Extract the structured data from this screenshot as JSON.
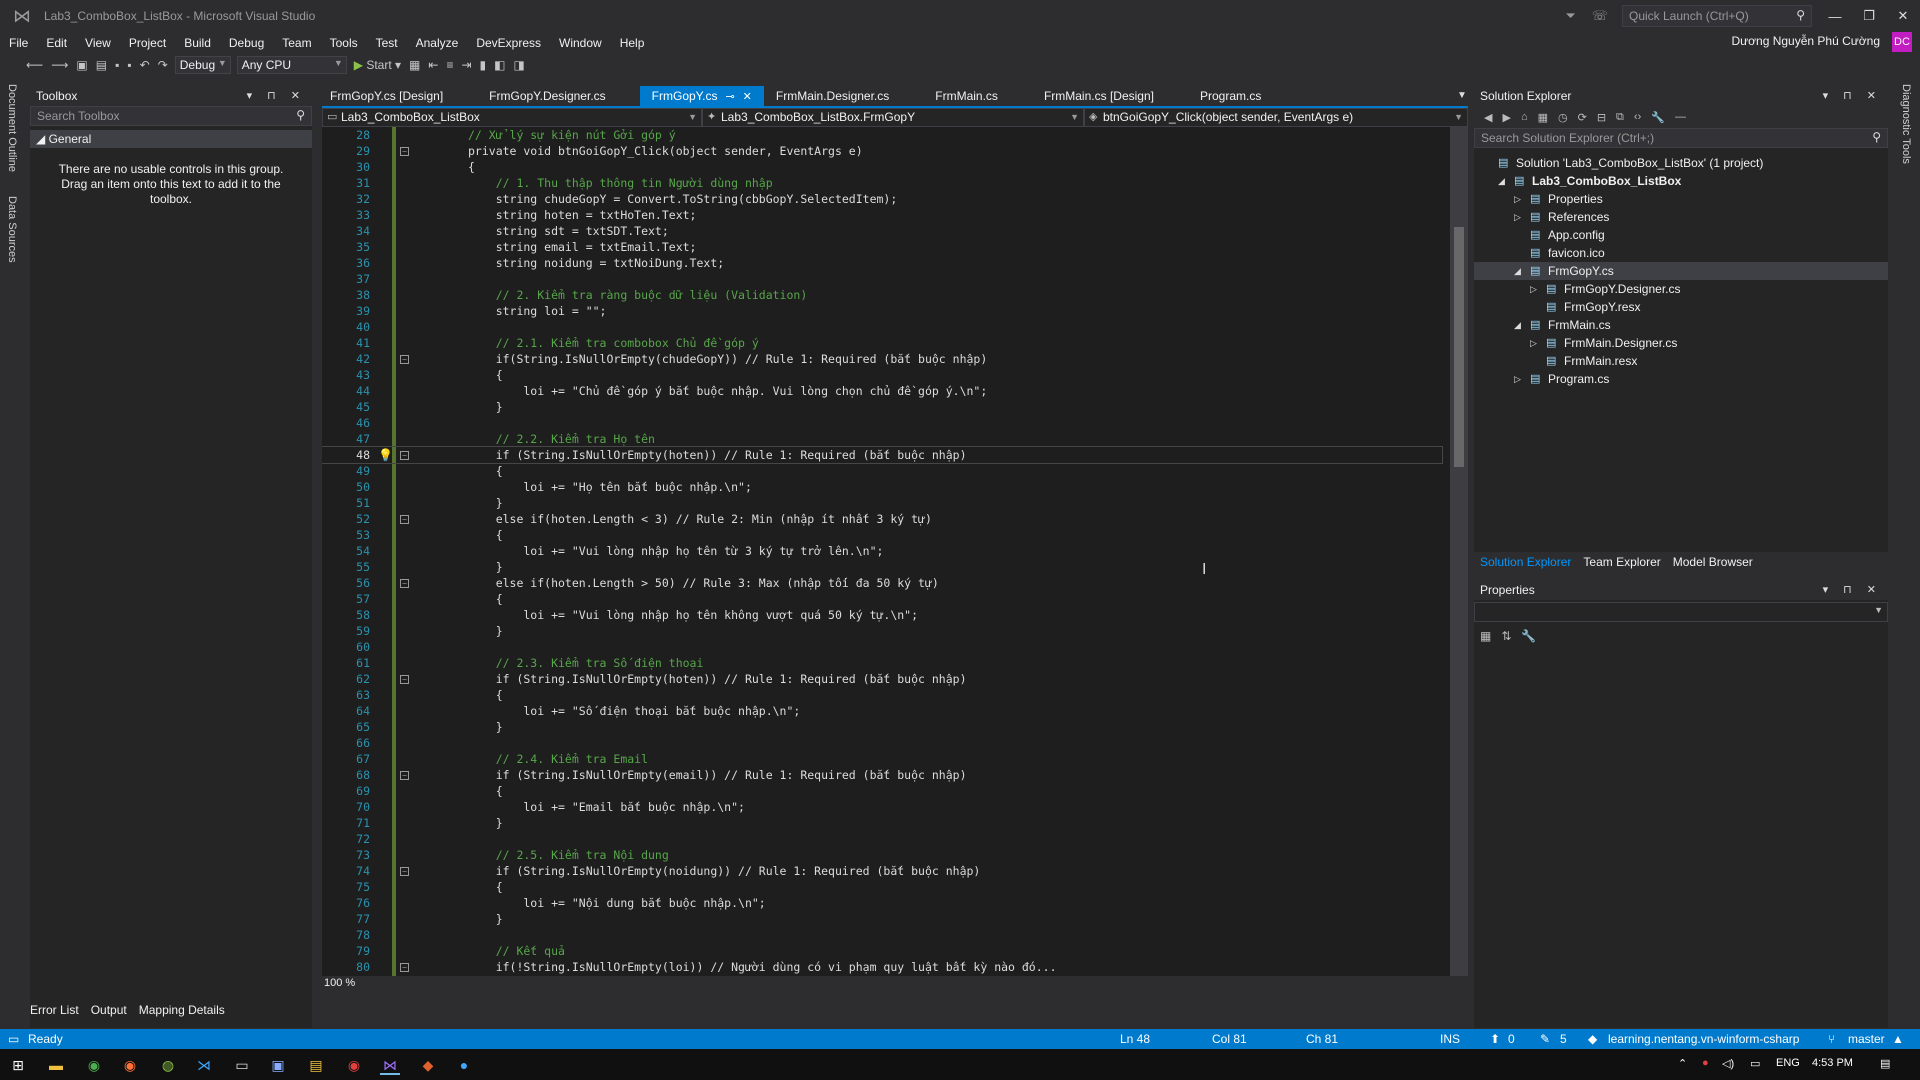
{
  "window": {
    "title": "Lab3_ComboBox_ListBox - Microsoft Visual Studio",
    "quick_launch_placeholder": "Quick Launch (Ctrl+Q)",
    "user_name": "Dương Nguyễn Phú Cường",
    "user_initials": "DC"
  },
  "menu": [
    "File",
    "Edit",
    "View",
    "Project",
    "Build",
    "Debug",
    "Team",
    "Tools",
    "Test",
    "Analyze",
    "DevExpress",
    "Window",
    "Help"
  ],
  "toolbar": {
    "configuration": "Debug",
    "platform": "Any CPU",
    "start_label": "Start"
  },
  "left_strip": [
    "Document Outline",
    "Data Sources"
  ],
  "right_strip": [
    "Diagnostic Tools"
  ],
  "toolbox": {
    "title": "Toolbox",
    "search_placeholder": "Search Toolbox",
    "group": "General",
    "empty_message": "There are no usable controls in this group. Drag an item onto this text to add it to the toolbox."
  },
  "tabs": [
    {
      "label": "FrmGopY.cs [Design]",
      "active": false
    },
    {
      "label": "FrmGopY.Designer.cs",
      "active": false
    },
    {
      "label": "FrmGopY.cs",
      "active": true
    },
    {
      "label": "FrmMain.Designer.cs",
      "active": false
    },
    {
      "label": "FrmMain.cs",
      "active": false
    },
    {
      "label": "FrmMain.cs [Design]",
      "active": false
    },
    {
      "label": "Program.cs",
      "active": false
    }
  ],
  "navbar": {
    "project": "Lab3_ComboBox_ListBox",
    "class": "Lab3_ComboBox_ListBox.FrmGopY",
    "member": "btnGoiGopY_Click(object sender, EventArgs e)"
  },
  "code": {
    "current_line": 48,
    "lines": [
      {
        "n": 28,
        "t": "// Xử lý sự kiện nút Gởi góp ý"
      },
      {
        "n": 29,
        "t": "private void btnGoiGopY_Click(object sender, EventArgs e)"
      },
      {
        "n": 30,
        "t": "{"
      },
      {
        "n": 31,
        "t": "    // 1. Thu thập thông tin Người dùng nhập"
      },
      {
        "n": 32,
        "t": "    string chudeGopY = Convert.ToString(cbbGopY.SelectedItem);"
      },
      {
        "n": 33,
        "t": "    string hoten = txtHoTen.Text;"
      },
      {
        "n": 34,
        "t": "    string sdt = txtSDT.Text;"
      },
      {
        "n": 35,
        "t": "    string email = txtEmail.Text;"
      },
      {
        "n": 36,
        "t": "    string noidung = txtNoiDung.Text;"
      },
      {
        "n": 37,
        "t": ""
      },
      {
        "n": 38,
        "t": "    // 2. Kiểm tra ràng buộc dữ liệu (Validation)"
      },
      {
        "n": 39,
        "t": "    string loi = \"\";"
      },
      {
        "n": 40,
        "t": ""
      },
      {
        "n": 41,
        "t": "    // 2.1. Kiểm tra combobox Chủ đề góp ý"
      },
      {
        "n": 42,
        "t": "    if(String.IsNullOrEmpty(chudeGopY)) // Rule 1: Required (bắt buộc nhập)"
      },
      {
        "n": 43,
        "t": "    {"
      },
      {
        "n": 44,
        "t": "        loi += \"Chủ đề góp ý bắt buộc nhập. Vui lòng chọn chủ đề góp ý.\\n\";"
      },
      {
        "n": 45,
        "t": "    }"
      },
      {
        "n": 46,
        "t": ""
      },
      {
        "n": 47,
        "t": "    // 2.2. Kiểm tra Họ tên"
      },
      {
        "n": 48,
        "t": "    if (String.IsNullOrEmpty(hoten)) // Rule 1: Required (bắt buộc nhập)"
      },
      {
        "n": 49,
        "t": "    {"
      },
      {
        "n": 50,
        "t": "        loi += \"Họ tên bắt buộc nhập.\\n\";"
      },
      {
        "n": 51,
        "t": "    }"
      },
      {
        "n": 52,
        "t": "    else if(hoten.Length < 3) // Rule 2: Min (nhập ít nhất 3 ký tự)"
      },
      {
        "n": 53,
        "t": "    {"
      },
      {
        "n": 54,
        "t": "        loi += \"Vui lòng nhập họ tên từ 3 ký tự trở lên.\\n\";"
      },
      {
        "n": 55,
        "t": "    }"
      },
      {
        "n": 56,
        "t": "    else if(hoten.Length > 50) // Rule 3: Max (nhập tối đa 50 ký tự)"
      },
      {
        "n": 57,
        "t": "    {"
      },
      {
        "n": 58,
        "t": "        loi += \"Vui lòng nhập họ tên không vượt quá 50 ký tự.\\n\";"
      },
      {
        "n": 59,
        "t": "    }"
      },
      {
        "n": 60,
        "t": ""
      },
      {
        "n": 61,
        "t": "    // 2.3. Kiểm tra Số điện thoại"
      },
      {
        "n": 62,
        "t": "    if (String.IsNullOrEmpty(hoten)) // Rule 1: Required (bắt buộc nhập)"
      },
      {
        "n": 63,
        "t": "    {"
      },
      {
        "n": 64,
        "t": "        loi += \"Số điện thoại bắt buộc nhập.\\n\";"
      },
      {
        "n": 65,
        "t": "    }"
      },
      {
        "n": 66,
        "t": ""
      },
      {
        "n": 67,
        "t": "    // 2.4. Kiểm tra Email"
      },
      {
        "n": 68,
        "t": "    if (String.IsNullOrEmpty(email)) // Rule 1: Required (bắt buộc nhập)"
      },
      {
        "n": 69,
        "t": "    {"
      },
      {
        "n": 70,
        "t": "        loi += \"Email bắt buộc nhập.\\n\";"
      },
      {
        "n": 71,
        "t": "    }"
      },
      {
        "n": 72,
        "t": ""
      },
      {
        "n": 73,
        "t": "    // 2.5. Kiểm tra Nội dung"
      },
      {
        "n": 74,
        "t": "    if (String.IsNullOrEmpty(noidung)) // Rule 1: Required (bắt buộc nhập)"
      },
      {
        "n": 75,
        "t": "    {"
      },
      {
        "n": 76,
        "t": "        loi += \"Nội dung bắt buộc nhập.\\n\";"
      },
      {
        "n": 77,
        "t": "    }"
      },
      {
        "n": 78,
        "t": ""
      },
      {
        "n": 79,
        "t": "    // Kết quả"
      },
      {
        "n": 80,
        "t": "    if(!String.IsNullOrEmpty(loi)) // Người dùng có vi phạm quy luật bất kỳ nào đó..."
      }
    ],
    "zoom": "100 %"
  },
  "solution_explorer": {
    "title": "Solution Explorer",
    "search_placeholder": "Search Solution Explorer (Ctrl+;)",
    "tree": [
      {
        "label": "Solution 'Lab3_ComboBox_ListBox' (1 project)",
        "level": 0,
        "expander": "",
        "icon": "solution-icon"
      },
      {
        "label": "Lab3_ComboBox_ListBox",
        "level": 1,
        "expander": "◢",
        "icon": "project-icon",
        "bold": true
      },
      {
        "label": "Properties",
        "level": 2,
        "expander": "▷",
        "icon": "wrench-icon"
      },
      {
        "label": "References",
        "level": 2,
        "expander": "▷",
        "icon": "references-icon"
      },
      {
        "label": "App.config",
        "level": 2,
        "expander": "",
        "icon": "config-icon"
      },
      {
        "label": "favicon.ico",
        "level": 2,
        "expander": "",
        "icon": "image-icon"
      },
      {
        "label": "FrmGopY.cs",
        "level": 2,
        "expander": "◢",
        "icon": "form-icon",
        "selected": true
      },
      {
        "label": "FrmGopY.Designer.cs",
        "level": 3,
        "expander": "▷",
        "icon": "csharp-file-icon"
      },
      {
        "label": "FrmGopY.resx",
        "level": 3,
        "expander": "",
        "icon": "resx-icon"
      },
      {
        "label": "FrmMain.cs",
        "level": 2,
        "expander": "◢",
        "icon": "form-icon"
      },
      {
        "label": "FrmMain.Designer.cs",
        "level": 3,
        "expander": "▷",
        "icon": "csharp-file-icon"
      },
      {
        "label": "FrmMain.resx",
        "level": 3,
        "expander": "",
        "icon": "resx-icon"
      },
      {
        "label": "Program.cs",
        "level": 2,
        "expander": "▷",
        "icon": "csharp-file-icon"
      }
    ],
    "bottom_tabs": [
      "Solution Explorer",
      "Team Explorer",
      "Model Browser"
    ]
  },
  "properties": {
    "title": "Properties"
  },
  "bottom_tabs": [
    "Error List",
    "Output",
    "Mapping Details"
  ],
  "status": {
    "ready": "Ready",
    "ln": "Ln 48",
    "col": "Col 81",
    "ch": "Ch 81",
    "mode": "INS",
    "up_count": "0",
    "pencil_count": "5",
    "repo": "learning.nentang.vn-winform-csharp",
    "branch": "master"
  },
  "taskbar": {
    "language": "ENG",
    "time": "4:53 PM"
  },
  "colors": {
    "accent": "#007acc",
    "editor_bg": "#1e1e1e",
    "keyword": "#569cd6",
    "type": "#4ec9b0",
    "string": "#d69d85",
    "comment": "#57a64a",
    "line_number": "#2b91af"
  }
}
